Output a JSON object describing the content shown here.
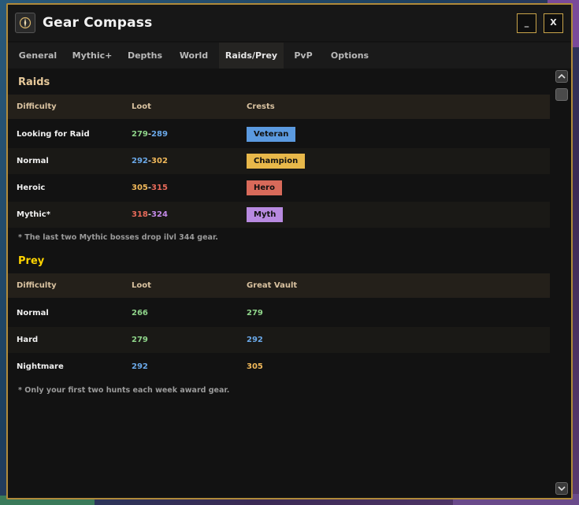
{
  "window": {
    "title": "Gear Compass",
    "min_label": "_",
    "close_label": "X"
  },
  "tabs": [
    {
      "label": "General"
    },
    {
      "label": "Mythic+"
    },
    {
      "label": "Depths"
    },
    {
      "label": "World"
    },
    {
      "label": "Raids/Prey"
    },
    {
      "label": "PvP"
    },
    {
      "label": "Options"
    }
  ],
  "active_tab": "Raids/Prey",
  "raids": {
    "title": "Raids",
    "headers": [
      "Difficulty",
      "Loot",
      "Crests"
    ],
    "rows": [
      {
        "difficulty": "Looking for Raid",
        "loot_min": "279",
        "loot_max": "289",
        "crest": "Veteran"
      },
      {
        "difficulty": "Normal",
        "loot_min": "292",
        "loot_max": "302",
        "crest": "Champion"
      },
      {
        "difficulty": "Heroic",
        "loot_min": "305",
        "loot_max": "315",
        "crest": "Hero"
      },
      {
        "difficulty": "Mythic*",
        "loot_min": "318",
        "loot_max": "324",
        "crest": "Myth"
      }
    ],
    "dash": "-",
    "note": "* The last two Mythic bosses drop ilvl 344 gear."
  },
  "prey": {
    "title": "Prey",
    "headers": [
      "Difficulty",
      "Loot",
      "Great Vault"
    ],
    "rows": [
      {
        "difficulty": "Normal",
        "loot": "266",
        "vault": "279"
      },
      {
        "difficulty": "Hard",
        "loot": "279",
        "vault": "292"
      },
      {
        "difficulty": "Nightmare",
        "loot": "292",
        "vault": "305"
      }
    ],
    "note": "* Only your first two hunts each week award gear."
  },
  "colors": {
    "border": "#b08a3a",
    "veteran": "#5b9ae0",
    "champion": "#e8b84a",
    "hero": "#d86a5a",
    "myth": "#b88ae0"
  }
}
